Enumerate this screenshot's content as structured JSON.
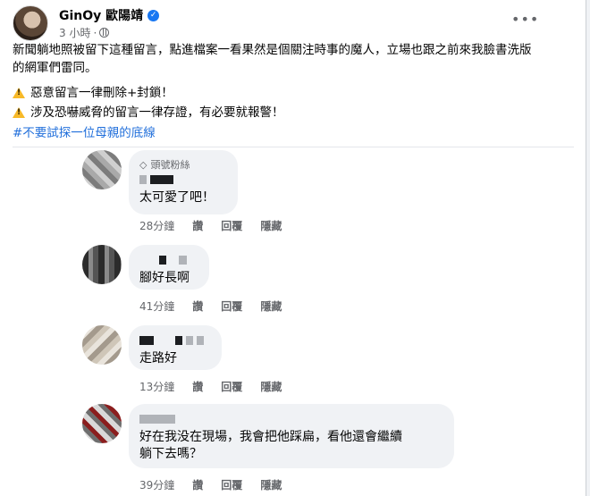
{
  "post": {
    "author": "GinOy 歐陽靖",
    "time": "3 小時",
    "body_line1": "新聞躺地照被留下這種留言，點進檔案一看果然是個關注時事的魔人，立場也跟之前來我臉書洗版",
    "body_line2": "的網軍們雷同。",
    "warning1": "惡意留言一律刪除+封鎖！",
    "warning2": "涉及恐嚇威脅的留言一律存證，有必要就報警！",
    "hashtag": "#不要試探一位母親的底線"
  },
  "actions": {
    "like": "讚",
    "reply": "回覆",
    "hide": "隱藏"
  },
  "comments": [
    {
      "badge": "頭號粉絲",
      "text": "太可愛了吧！",
      "time": "28分鐘"
    },
    {
      "badge": "",
      "text": "腳好長啊",
      "time": "41分鐘"
    },
    {
      "badge": "",
      "text": "走路好",
      "time": "13分鐘"
    },
    {
      "badge": "",
      "text_line1": "好在我没在現場，我會把他踩扁，看他還會繼續",
      "text_line2": "躺下去嗎？",
      "time": "39分鐘"
    }
  ],
  "icons": [
    "verified-icon",
    "globe-icon",
    "more-icon",
    "warning-icon",
    "diamond-icon"
  ],
  "colors": {
    "link": "#216fdb",
    "verified": "#1877f2",
    "bubble": "#f0f2f5",
    "warning": "#f7b928"
  }
}
